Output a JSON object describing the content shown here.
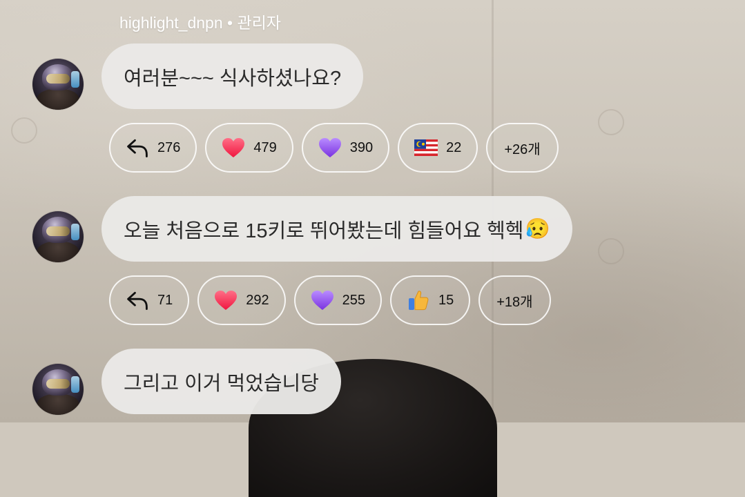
{
  "header": {
    "username_line": "highlight_dnpn • 관리자"
  },
  "messages": [
    {
      "text": "여러분~~~ 식사하셨나요?",
      "emoji": "",
      "reactions": {
        "reply_count": "276",
        "heart_count": "479",
        "purple_heart_count": "390",
        "flag_count": "22",
        "more_label": "+26개"
      }
    },
    {
      "text": "오늘 처음으로 15키로 뛰어봤는데 힘들어요 헥헥",
      "emoji": "😥",
      "reactions": {
        "reply_count": "71",
        "heart_count": "292",
        "purple_heart_count": "255",
        "thumbs_count": "15",
        "more_label": "+18개"
      }
    },
    {
      "text": "그리고 이거 먹었습니당",
      "emoji": ""
    }
  ],
  "icons": {
    "reply": "reply-arrow-icon",
    "heart": "red-heart-icon",
    "purple_heart": "purple-heart-icon",
    "flag": "malaysia-flag-icon",
    "thumbs": "thumbs-up-icon"
  },
  "colors": {
    "bubble_bg": "#eae9e7",
    "chip_border": "#ffffff",
    "heart_red": "#ff3b5c",
    "heart_purple": "#9b5cf0",
    "thumbs_yellow": "#f6b73c"
  }
}
